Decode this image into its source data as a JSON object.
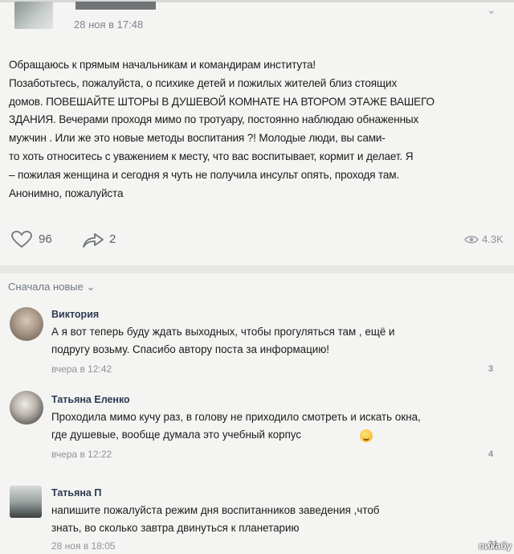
{
  "post": {
    "date": "28 ноя в 17:48",
    "text": "Обращаюсь к прямым начальникам и командирам института!\nПозаботьтесь, пожалуйста, о психике детей и пожилых жителей близ стоящих\nдомов. ПОВЕШАЙТЕ ШТОРЫ В ДУШЕВОЙ КОМНАТЕ НА ВТОРОМ ЭТАЖЕ ВАШЕГО\nЗДАНИЯ. Вечерами проходя мимо по тротуару, постоянно наблюдаю обнаженных\nмужчин . Или же это новые методы воспитания ?! Молодые люди, вы сами-\nто хоть относитесь с уважением к месту, что вас воспитывает, кормит и делает. Я\n– пожилая женщина и сегодня я чуть не получила инсульт опять, проходя там.\nАнонимно, пожалуйста",
    "likes": "96",
    "shares": "2",
    "views": "4.3K",
    "more_icon": "chevron-down-icon"
  },
  "comments_sort": "Сначала новые ⌄",
  "comments": [
    {
      "name": "Виктория",
      "text": "А я вот теперь буду ждать выходных, чтобы прогуляться там , ещё и\nподругу возьму. Спасибо автору поста за информацию!",
      "date": "вчера в 12:42",
      "likes": "3"
    },
    {
      "name": "Татьяна Еленко",
      "text": "Проходила мимо кучу раз, в голову не приходило смотреть и искать окна,\nгде душевые, вообще думала это учебный корпус",
      "date": "вчера в 12:22",
      "likes": "4"
    },
    {
      "name": "Татьяна П",
      "text": "напишите пожалуйста режим дня воспитанников заведения ,чтоб\nзнать, во сколько завтра двинуться к планетарию",
      "date": "28 ноя в 18:05",
      "likes": "21"
    }
  ],
  "watermark": "пикабу",
  "colors": {
    "name": "#2c3b52",
    "muted": "#8d939a",
    "background": "#f4f4f2"
  }
}
